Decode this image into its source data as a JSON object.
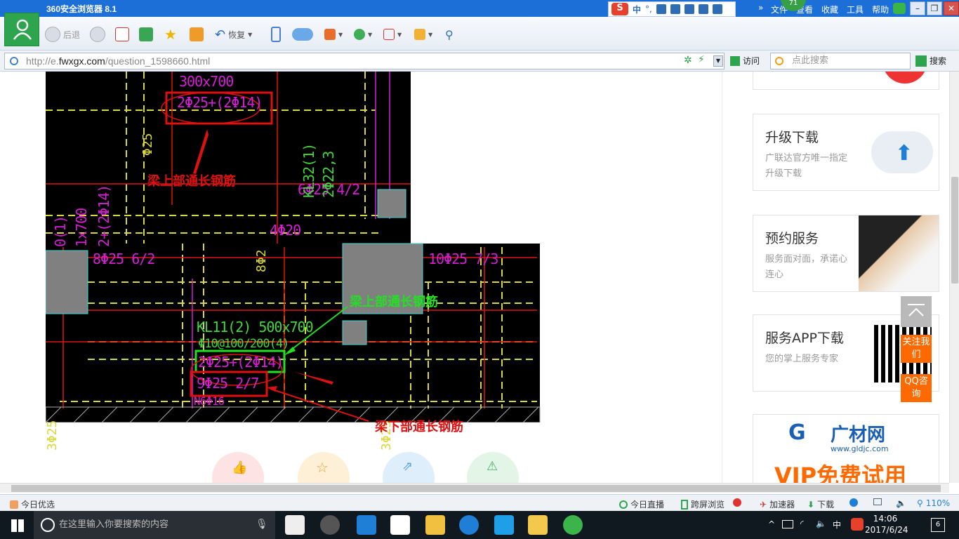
{
  "browser": {
    "title": "360安全浏览器 8.1",
    "badge_count": "71",
    "menus": [
      "文件",
      "查看",
      "收藏",
      "工具",
      "帮助"
    ],
    "ime": {
      "logo": "S",
      "mode": "中",
      "punct": "°,"
    }
  },
  "toolbar": {
    "back_label": "后退",
    "restore_label": "恢复"
  },
  "address": {
    "url_prefix": "http://e.",
    "url_domain": "fwxgx.com",
    "url_path": "/question_1598660.html",
    "visit_label": "访问",
    "search_placeholder": "点此搜索",
    "search_label": "搜索"
  },
  "cad": {
    "labels_magenta": [
      "300x700",
      "2Φ25+(2Φ14)",
      "6Φ25 4/2",
      "4Φ20",
      "8Φ25 6/2",
      "10Φ25 7/3",
      "2Φ25+(2Φ14)",
      "9Φ25 2/7",
      "N6Φ16",
      "Φ25",
      "3Φ25",
      "3Φ25",
      "8Φ2",
      "KL32(1)",
      "2Φ22,3",
      "0(1)",
      "1x700",
      "2+(2Φ14)"
    ],
    "labels_green": [
      "KL11(2) 500x700",
      "Φ10@100/200(4)"
    ],
    "ann_top": "梁上部通长钢筋",
    "ann_mid": "梁上部通长钢筋",
    "ann_bottom": "梁下部通长钢筋"
  },
  "sidebar": {
    "cards": [
      {
        "title": "升级下载",
        "desc": "广联达官方唯一指定升级下载"
      },
      {
        "title": "预约服务",
        "desc": "服务面对面，承诺心连心"
      },
      {
        "title": "服务APP下载",
        "desc": "您的掌上服务专家"
      }
    ],
    "follow_label": "关注我们",
    "qq_label": "QQ咨询",
    "ad": {
      "brand": "广材网",
      "url": "www.gldjc.com",
      "promo": "VIP免费试用"
    }
  },
  "statusbar": {
    "left": "今日优选",
    "live": "今日直播",
    "cross": "跨屏浏览",
    "accel": "加速器",
    "download": "下载",
    "zoom": "110%"
  },
  "taskbar": {
    "search_placeholder": "在这里输入你要搜索的内容",
    "ime": "中",
    "time": "14:06",
    "date": "2017/6/24",
    "notif_count": "6"
  },
  "colors": {
    "title_bar": "#1d6fd8",
    "cad_magenta": "#d61ed6",
    "cad_green": "#44d640",
    "annotation_red": "#e01010",
    "annotation_green": "#22e022",
    "orange": "#ff6a00"
  }
}
